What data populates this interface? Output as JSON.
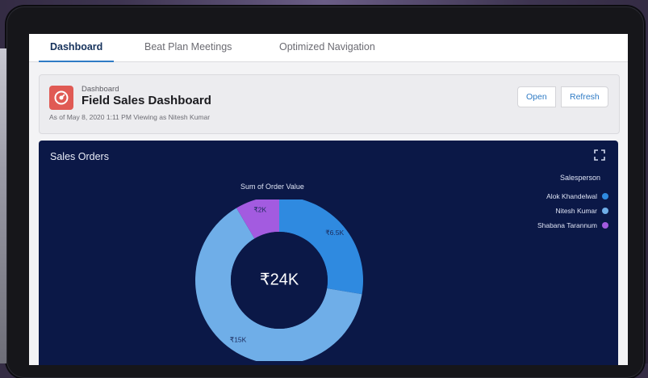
{
  "tabs": [
    {
      "label": "Dashboard"
    },
    {
      "label": "Beat Plan Meetings"
    },
    {
      "label": "Optimized Navigation"
    }
  ],
  "header": {
    "breadcrumb": "Dashboard",
    "title": "Field Sales Dashboard",
    "subtitle": "As of May 8, 2020 1:11 PM Viewing as Nitesh Kumar",
    "open_label": "Open",
    "refresh_label": "Refresh"
  },
  "panel": {
    "title": "Sales Orders"
  },
  "chart_data": {
    "type": "pie",
    "title": "Sum of Order Value",
    "center_label": "₹24K",
    "legend_title": "Salesperson",
    "legend_position": "top-right",
    "series": [
      {
        "name": "Alok Khandelwal",
        "value": 6.5,
        "label": "₹6.5K",
        "color": "#2f8ae0"
      },
      {
        "name": "Nitesh Kumar",
        "value": 15,
        "label": "₹15K",
        "color": "#6faee8"
      },
      {
        "name": "Shabana Tarannum",
        "value": 2,
        "label": "₹2K",
        "color": "#a35be0"
      }
    ]
  }
}
